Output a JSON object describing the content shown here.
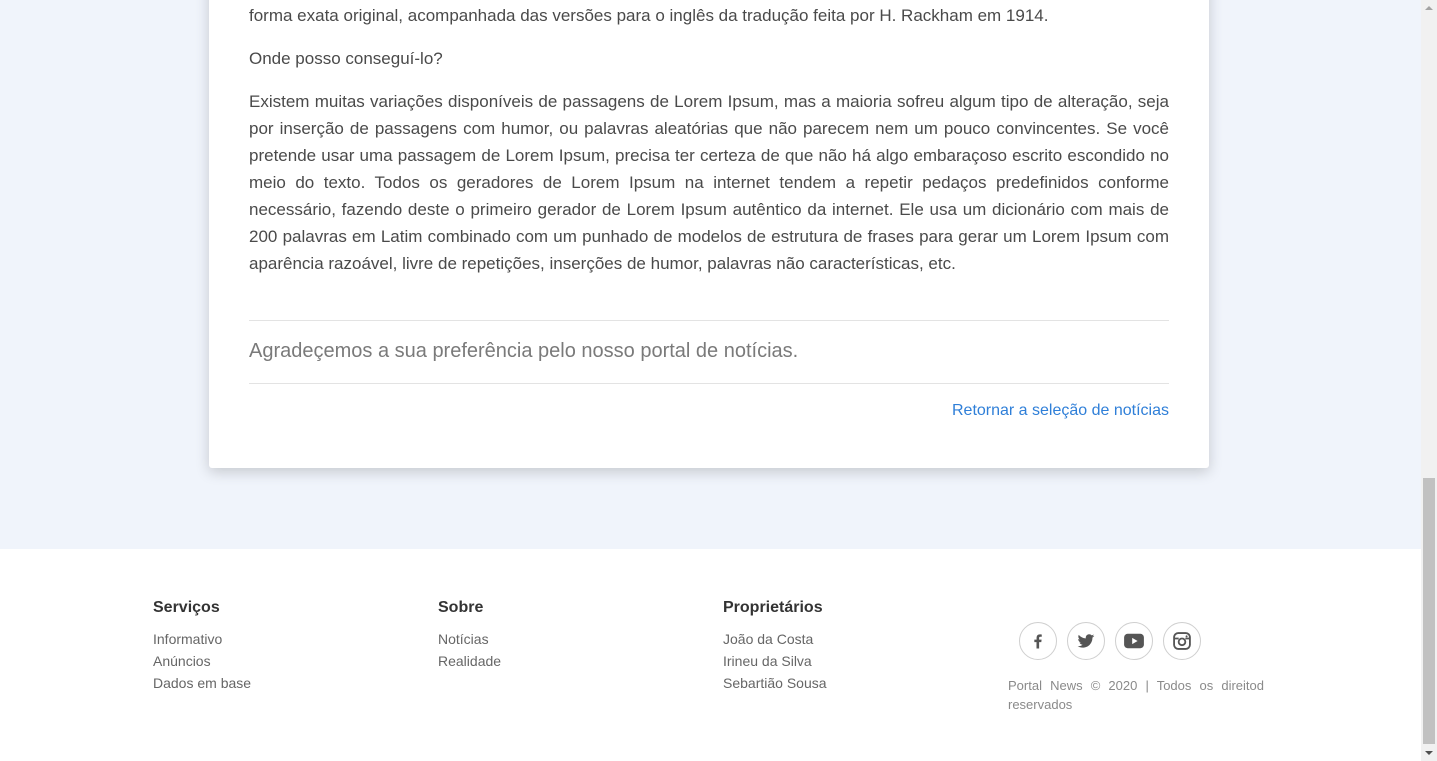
{
  "article": {
    "intro_line": "forma exata original, acompanhada das versões para o inglês da tradução feita por H. Rackham em 1914.",
    "question": "Onde posso conseguí-lo?",
    "paragraph": "Existem muitas variações disponíveis de passagens de Lorem Ipsum, mas a maioria sofreu algum tipo de alteração, seja por inserção de passagens com humor, ou palavras aleatórias que não parecem nem um pouco convincentes. Se você pretende usar uma passagem de Lorem Ipsum, precisa ter certeza de que não há algo embaraçoso escrito escondido no meio do texto. Todos os geradores de Lorem Ipsum na internet tendem a repetir pedaços predefinidos conforme necessário, fazendo deste o primeiro gerador de Lorem Ipsum autêntico da internet. Ele usa um dicionário com mais de 200 palavras em Latim combinado com um punhado de modelos de estrutura de frases para gerar um Lorem Ipsum com aparência razoável, livre de repetições, inserções de humor, palavras não características, etc.",
    "thanks": "Agradeçemos a sua preferência pelo nosso portal de notícias.",
    "back_link": "Retornar a seleção de notícias"
  },
  "footer": {
    "services": {
      "title": "Serviços",
      "items": [
        "Informativo",
        "Anúncios",
        "Dados em base"
      ]
    },
    "about": {
      "title": "Sobre",
      "items": [
        "Notícias",
        "Realidade"
      ]
    },
    "owners": {
      "title": "Proprietários",
      "items": [
        "João da Costa",
        "Irineu da Silva",
        "Sebartião Sousa"
      ]
    },
    "social_icons": [
      "facebook-icon",
      "twitter-icon",
      "youtube-icon",
      "instagram-icon"
    ],
    "copyright": "Portal News © 2020 | Todos os direitod reservados"
  },
  "colors": {
    "page_background": "#f0f4fb",
    "link": "#2f7fd8",
    "text": "#4a4a4a"
  }
}
